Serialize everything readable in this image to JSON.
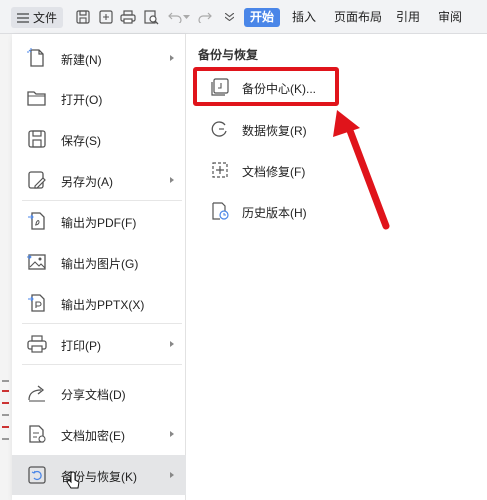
{
  "toolbar": {
    "file_label": "文件",
    "tabs": [
      "开始",
      "插入",
      "页面布局",
      "引用",
      "审阅"
    ],
    "icons": [
      "menu-icon",
      "save-icon",
      "export-icon",
      "print-icon",
      "print-preview-icon",
      "undo-icon",
      "redo-icon",
      "dropdown-icon"
    ]
  },
  "menu": {
    "items": [
      {
        "label": "新建(N)",
        "icon": "new-file-icon",
        "has_submenu": true
      },
      {
        "label": "打开(O)",
        "icon": "open-folder-icon",
        "has_submenu": false
      },
      {
        "label": "保存(S)",
        "icon": "save-icon",
        "has_submenu": false
      },
      {
        "label": "另存为(A)",
        "icon": "save-as-icon",
        "has_submenu": true
      },
      {
        "label": "输出为PDF(F)",
        "icon": "export-pdf-icon",
        "has_submenu": false
      },
      {
        "label": "输出为图片(G)",
        "icon": "export-image-icon",
        "has_submenu": false
      },
      {
        "label": "输出为PPTX(X)",
        "icon": "export-pptx-icon",
        "has_submenu": false
      },
      {
        "label": "打印(P)",
        "icon": "print-icon",
        "has_submenu": true
      },
      {
        "label": "分享文档(D)",
        "icon": "share-icon",
        "has_submenu": false
      },
      {
        "label": "文档加密(E)",
        "icon": "encrypt-icon",
        "has_submenu": true
      },
      {
        "label": "备份与恢复(K)",
        "icon": "backup-restore-icon",
        "has_submenu": true
      }
    ],
    "active_item": "备份与恢复(K)"
  },
  "submenu": {
    "title": "备份与恢复",
    "items": [
      {
        "label": "备份中心(K)...",
        "icon": "backup-center-icon",
        "highlighted": true
      },
      {
        "label": "数据恢复(R)",
        "icon": "data-recovery-icon",
        "highlighted": false
      },
      {
        "label": "文档修复(F)",
        "icon": "document-repair-icon",
        "highlighted": false
      },
      {
        "label": "历史版本(H)",
        "icon": "history-version-icon",
        "highlighted": false
      }
    ]
  },
  "colors": {
    "accent": "#4a86e8",
    "annotation_red": "#e0141b",
    "hover_bg": "#e4e5e7"
  }
}
